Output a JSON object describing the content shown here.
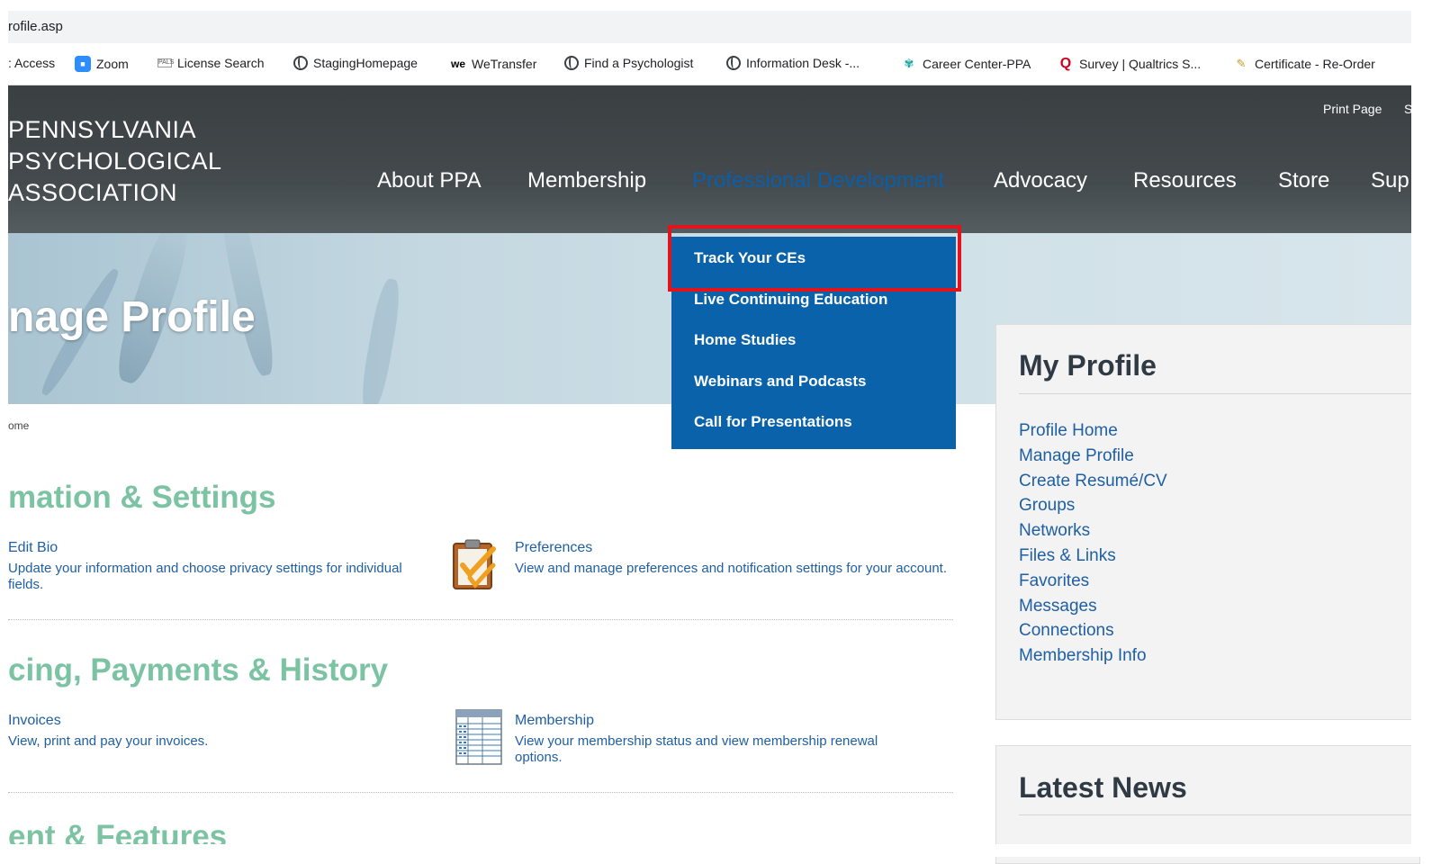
{
  "browser": {
    "url": "rofile.asp",
    "bookmarks": [
      {
        "label": ": Access",
        "icon": ""
      },
      {
        "label": "Zoom",
        "icon": "zoom-icon"
      },
      {
        "label": "License Search",
        "icon": "license-icon"
      },
      {
        "label": "StagingHomepage",
        "icon": "globe-icon"
      },
      {
        "label": "WeTransfer",
        "icon": "wetransfer-icon"
      },
      {
        "label": "Find a Psychologist",
        "icon": "globe-icon"
      },
      {
        "label": "Information Desk -...",
        "icon": "globe-icon"
      },
      {
        "label": "Career Center-PPA",
        "icon": "career-icon"
      },
      {
        "label": "Survey | Qualtrics S...",
        "icon": "qualtrics-icon"
      },
      {
        "label": "Certificate - Re-Order",
        "icon": "certificate-icon"
      }
    ]
  },
  "site": {
    "logo_lines": [
      "PENNSYLVANIA",
      "PSYCHOLOGICAL",
      "ASSOCIATION"
    ],
    "utility": {
      "print": "Print Page",
      "second": "S"
    },
    "nav": [
      "About PPA",
      "Membership",
      "Professional Development",
      "Advocacy",
      "Resources",
      "Store",
      "Sup"
    ],
    "active_nav_color": "#0a5fa8"
  },
  "dropdown": {
    "items": [
      "Track Your CEs",
      "Live Continuing Education",
      "Home Studies",
      "Webinars and Podcasts",
      "Call for Presentations"
    ],
    "highlighted": "Track Your CEs",
    "highlight_color": "#e3131b",
    "bg_color": "#0a62aa"
  },
  "page": {
    "title": "nage Profile",
    "breadcrumb": "ome",
    "sections": [
      {
        "heading": "mation & Settings",
        "items": [
          {
            "link": "Edit Bio",
            "desc": "Update your information and choose privacy settings for individual fields."
          },
          {
            "link": "Preferences",
            "desc": "View and manage preferences and notification settings for your account."
          }
        ]
      },
      {
        "heading": "cing, Payments & History",
        "items": [
          {
            "link": "Invoices",
            "desc": "View, print and pay your invoices."
          },
          {
            "link": "Membership",
            "desc": "View your membership status and view membership renewal options."
          }
        ]
      },
      {
        "heading": "ent & Features",
        "items": []
      }
    ],
    "heading_color": "#7bc3a2"
  },
  "sidebar": {
    "title": "My Profile",
    "links": [
      "Profile Home",
      "Manage Profile",
      "Create Resumé/CV",
      "Groups",
      "Networks",
      "Files & Links",
      "Favorites",
      "Messages",
      "Connections",
      "Membership Info"
    ],
    "news_title": "Latest News"
  }
}
